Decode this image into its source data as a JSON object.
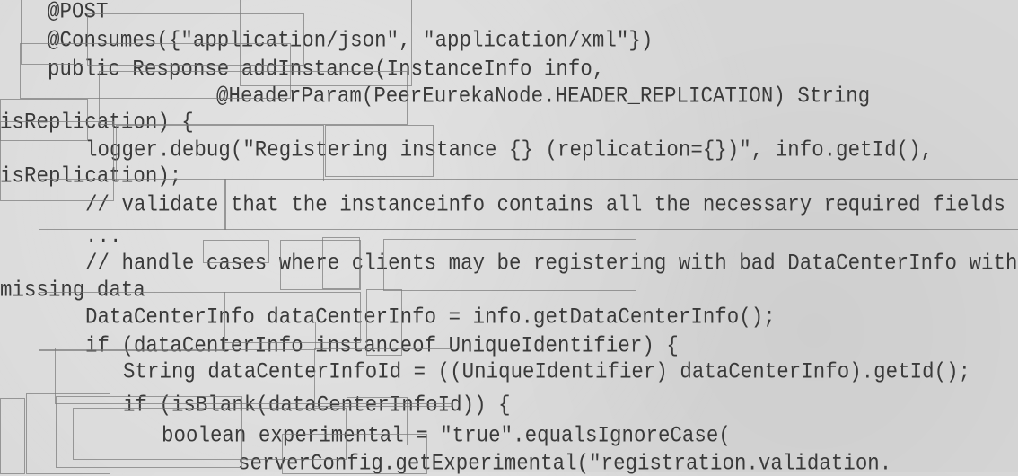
{
  "code_lines": [
    "@POST",
    "@Consumes({\"application/json\", \"application/xml\"})",
    "public Response addInstance(InstanceInfo info,",
    "@HeaderParam(PeerEurekaNode.HEADER_REPLICATION) String",
    "isReplication) {",
    "logger.debug(\"Registering instance {} (replication={})\", info.getId(),",
    "isReplication);",
    "// validate that the instanceinfo contains all the necessary required fields",
    "...",
    "// handle cases where clients may be registering with bad DataCenterInfo with",
    "missing data",
    "DataCenterInfo dataCenterInfo = info.getDataCenterInfo();",
    "if (dataCenterInfo instanceof UniqueIdentifier) {",
    "String dataCenterInfoId = ((UniqueIdentifier) dataCenterInfo).getId();",
    "if (isBlank(dataCenterInfoId)) {",
    "boolean experimental = \"true\".equalsIgnoreCase(",
    "serverConfig.getExperimental(\"registration.validation."
  ]
}
